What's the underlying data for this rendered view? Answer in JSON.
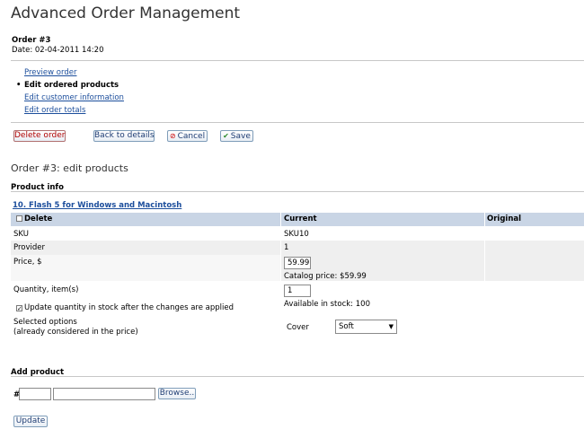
{
  "page": {
    "title": "Advanced Order Management"
  },
  "order": {
    "number_label": "Order #3",
    "date_label": "Date: 02-04-2011 14:20"
  },
  "nav": {
    "items": [
      {
        "label": "Preview order",
        "current": false
      },
      {
        "label": "Edit ordered products",
        "current": true
      },
      {
        "label": "Edit customer information",
        "current": false
      },
      {
        "label": "Edit order totals",
        "current": false
      }
    ]
  },
  "actions": {
    "delete_order": "Delete order",
    "back_to_details": "Back to details",
    "cancel": "Cancel",
    "save": "Save"
  },
  "section": {
    "title": "Order #3: edit products",
    "product_info": "Product info"
  },
  "product": {
    "link": "10. Flash 5 for Windows and Macintosh",
    "columns": {
      "delete": "Delete",
      "current": "Current",
      "original": "Original"
    },
    "rows": {
      "sku": {
        "label": "SKU",
        "current": "SKU10"
      },
      "provider": {
        "label": "Provider",
        "current": "1"
      },
      "price": {
        "label": "Price, $",
        "value": "59.99",
        "catalog": "Catalog price: $59.99"
      },
      "quantity": {
        "label": "Quantity, item(s)",
        "value": "1",
        "available": "Available in stock: 100",
        "update_stock": "Update quantity in stock after the changes are applied"
      },
      "options": {
        "label_line1": "Selected options",
        "label_line2": "(already considered in the price)",
        "option_name": "Cover",
        "option_value": "Soft"
      }
    }
  },
  "add_product": {
    "title": "Add product",
    "hash": "#",
    "browse": "Browse..",
    "update": "Update"
  },
  "colors": {
    "link": "#1c4e9c",
    "table_header": "#c9d5e5",
    "row_alt": "#efefef"
  }
}
